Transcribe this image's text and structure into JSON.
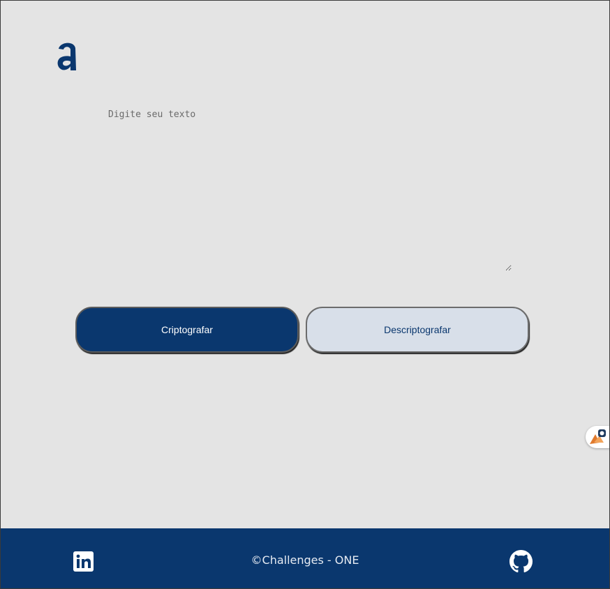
{
  "header": {
    "logo_icon": "alura-a-logo-icon"
  },
  "editor": {
    "placeholder": "Digite seu texto",
    "value": ""
  },
  "actions": {
    "encrypt_label": "Criptografar",
    "decrypt_label": "Descriptografar"
  },
  "footer": {
    "copyright": "©Challenges - ONE",
    "left_icon": "linkedin-icon",
    "right_icon": "github-icon"
  },
  "colors": {
    "background": "#e4e4e4",
    "primary": "#0a376e",
    "secondary_button": "#d8dfe9",
    "footer_text": "#e6ebf3"
  }
}
